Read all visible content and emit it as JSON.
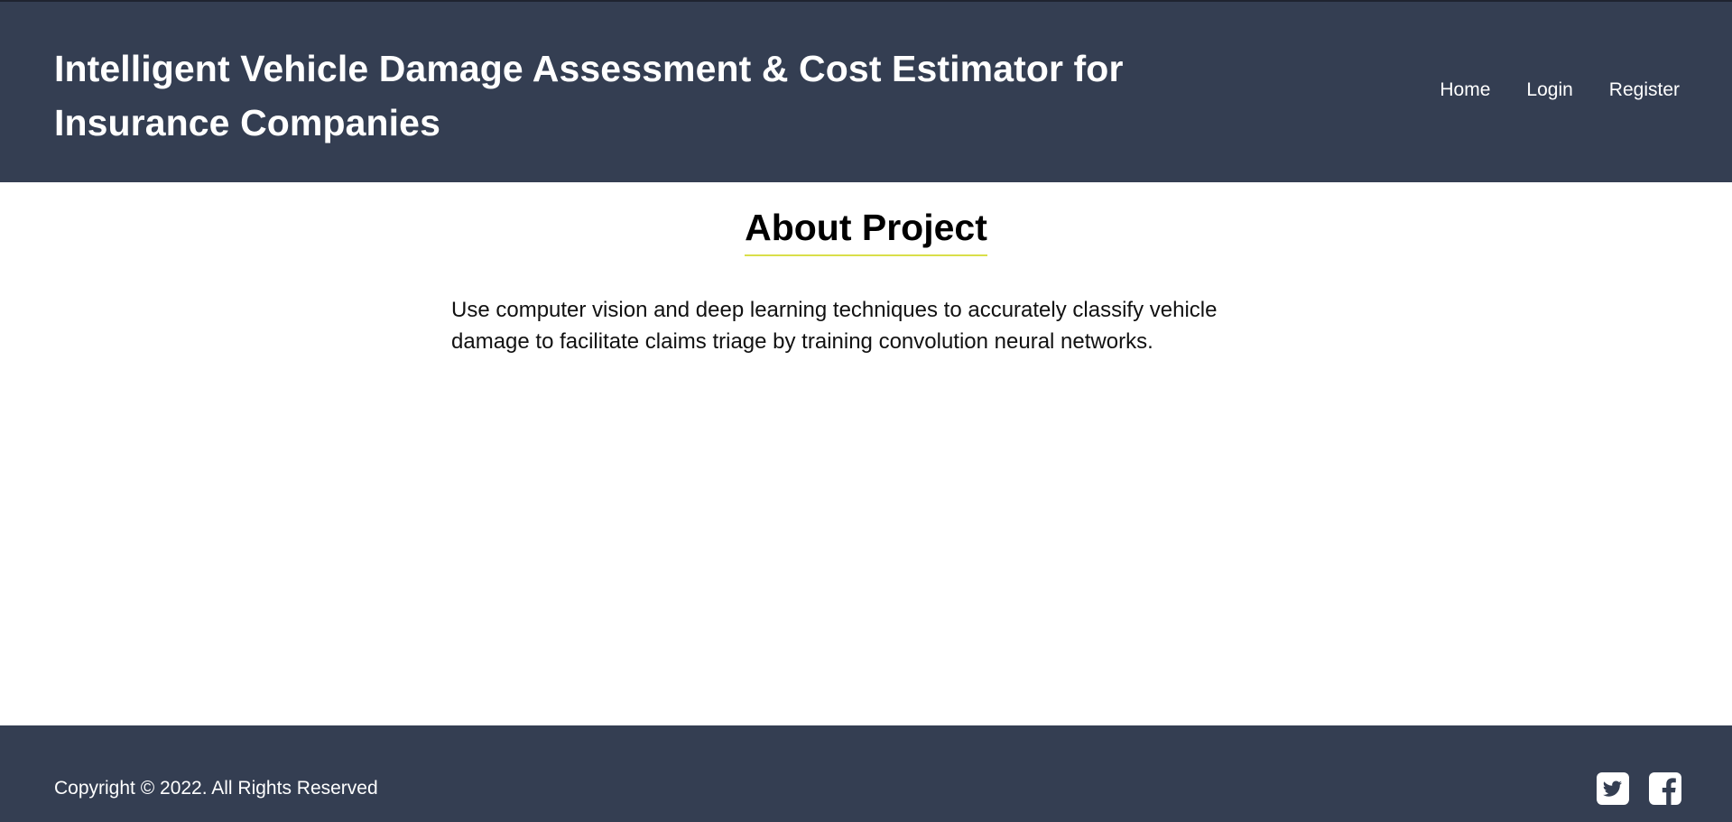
{
  "header": {
    "title": "Intelligent Vehicle Damage Assessment & Cost Estimator for Insurance Companies",
    "nav": [
      {
        "label": "Home"
      },
      {
        "label": "Login"
      },
      {
        "label": "Register"
      }
    ]
  },
  "main": {
    "heading": "About Project",
    "description": "Use computer vision and deep learning techniques to accurately classify vehicle damage to facilitate claims triage by training convolution neural networks."
  },
  "footer": {
    "copyright": "Copyright © 2022. All Rights Reserved",
    "social_icons": [
      "twitter-icon",
      "facebook-icon"
    ]
  },
  "colors": {
    "header_bg": "#343e52",
    "footer_bg": "#343e52",
    "accent_underline": "#d9df4a",
    "text_light": "#ffffff",
    "text_dark": "#000000"
  }
}
